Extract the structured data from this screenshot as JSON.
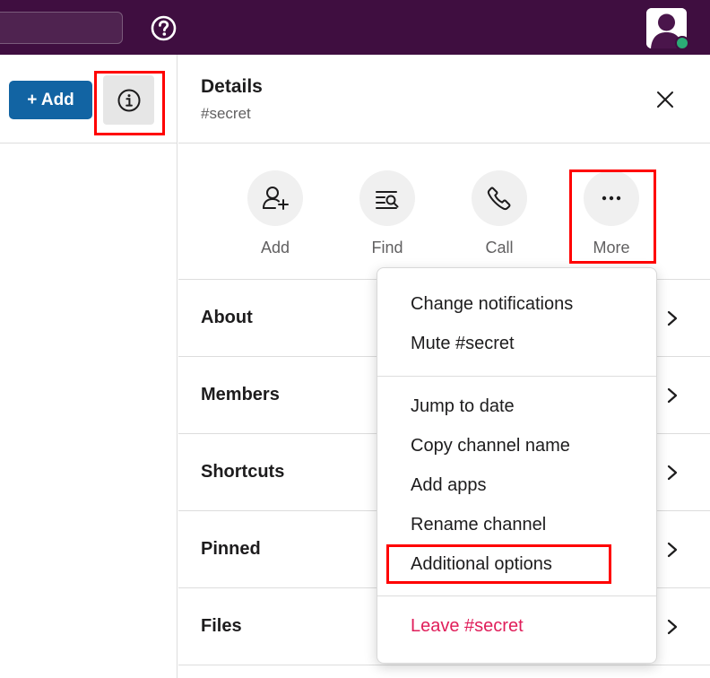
{
  "topbar": {
    "help_icon": "help-circle-icon",
    "avatar_icon": "user-avatar-icon",
    "status_color": "#2bac76",
    "background_color": "#3f0e40"
  },
  "left_pane": {
    "add_button_label": "+ Add",
    "info_icon": "info-circle-icon"
  },
  "details": {
    "title": "Details",
    "channel": "#secret",
    "close_icon": "close-icon"
  },
  "actions": [
    {
      "label": "Add",
      "icon": "add-person-icon"
    },
    {
      "label": "Find",
      "icon": "find-in-list-icon"
    },
    {
      "label": "Call",
      "icon": "phone-icon"
    },
    {
      "label": "More",
      "icon": "more-horizontal-icon"
    }
  ],
  "sections": [
    {
      "label": "About"
    },
    {
      "label": "Members"
    },
    {
      "label": "Shortcuts"
    },
    {
      "label": "Pinned"
    },
    {
      "label": "Files"
    }
  ],
  "menu": {
    "group1": [
      "Change notifications",
      "Mute #secret"
    ],
    "group2": [
      "Jump to date",
      "Copy channel name",
      "Add apps",
      "Rename channel",
      "Additional options"
    ],
    "danger": "Leave #secret",
    "danger_color": "#e01e5a"
  },
  "accent_color": "#1264a3",
  "highlight_color": "#ff0000"
}
